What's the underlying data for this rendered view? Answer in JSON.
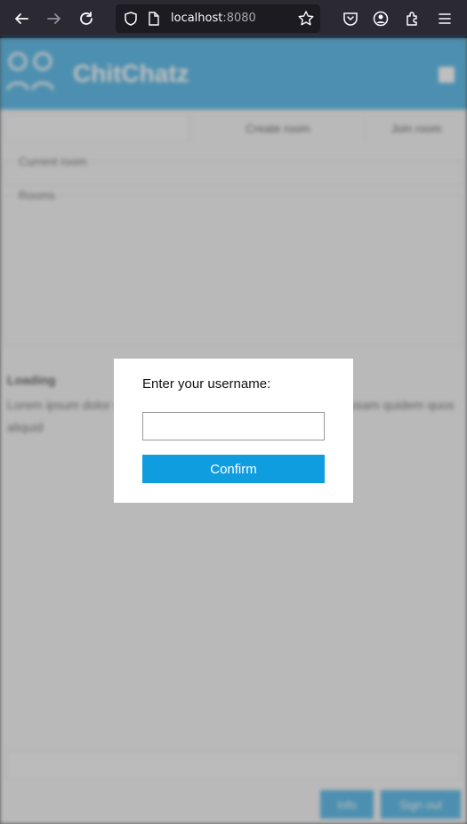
{
  "browser": {
    "url_host": "localhost",
    "url_port": ":8080",
    "icons": [
      "back-icon",
      "forward-icon",
      "reload-icon",
      "shield-icon",
      "page-icon",
      "bookmark-star-icon",
      "pocket-icon",
      "account-icon",
      "extensions-icon",
      "menu-icon"
    ]
  },
  "app": {
    "brand": "ChitChatz",
    "room_bar": {
      "create_room_label": "Create room",
      "join_room_label": "Join room"
    },
    "current_room_legend": "Current room",
    "rooms_legend": "Rooms",
    "loading_title": "Loading",
    "loading_text": "Lorem ipsum dolor sit amet consectetur adipisicing elit. Quas ipsam quidem quos aliquid",
    "bottom": {
      "info_label": "Info",
      "sign_out_label": "Sign out"
    },
    "colors": {
      "brand": "#1a9fe0",
      "overlay": "rgba(128,128,128,0.5)"
    }
  },
  "dialog": {
    "label": "Enter your username:",
    "input_value": "",
    "input_placeholder": "",
    "confirm_label": "Confirm",
    "confirm_color": "#109ddf"
  }
}
